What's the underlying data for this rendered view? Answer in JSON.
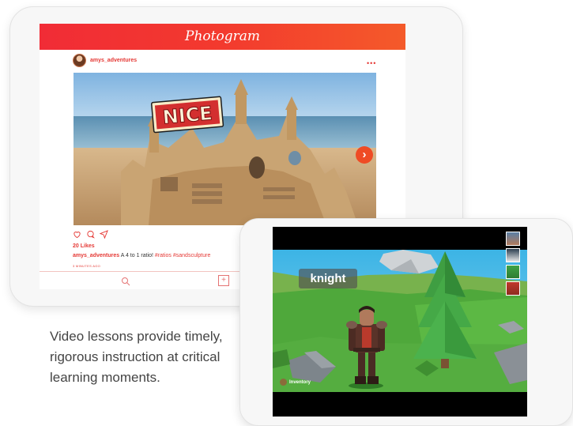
{
  "photogram": {
    "title": "Photogram",
    "username": "amys_adventures",
    "more_label": "•••",
    "image_text": "NICE",
    "next_label": "›",
    "likes": "20 Likes",
    "caption_user": "amys_adventures",
    "caption_text": " A 4 to 1 ratio! ",
    "caption_tags": "#ratios #sandsculpture",
    "time": "3 MINUTES AGO",
    "add_label": "+",
    "accent": "#e53935"
  },
  "game": {
    "vocab_word": "knight",
    "inventory_label": "Inventory"
  },
  "promo": {
    "text": "Video lessons provide timely, rigorous instruction at critical learning moments."
  }
}
